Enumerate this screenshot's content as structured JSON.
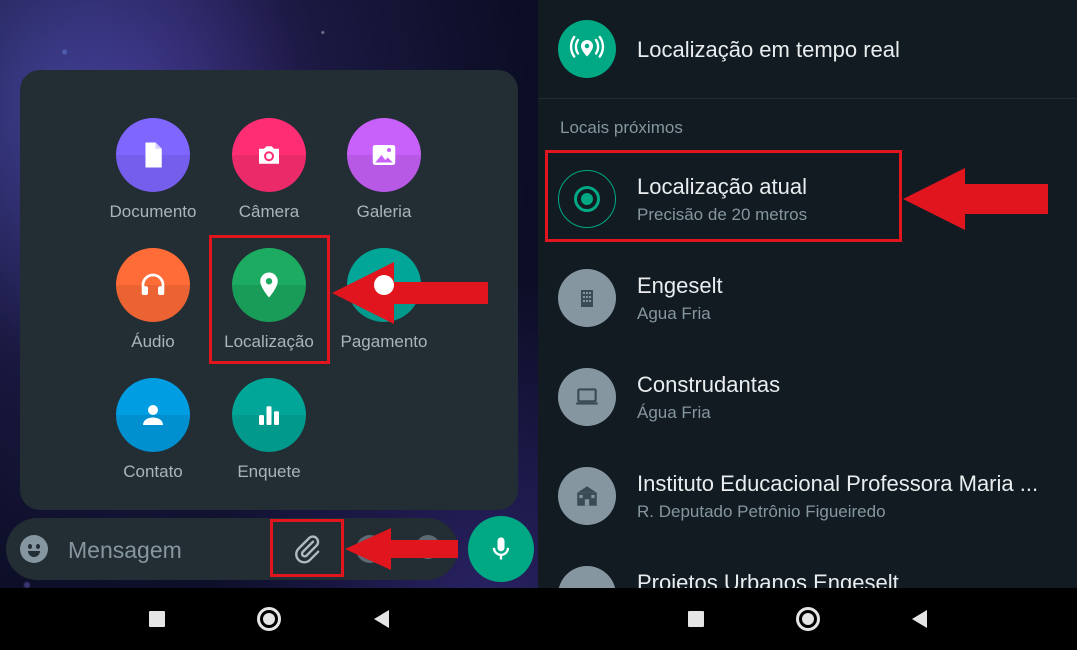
{
  "left": {
    "attach_items": [
      {
        "label": "Documento",
        "icon": "document-icon",
        "color": "#7f66ff"
      },
      {
        "label": "Câmera",
        "icon": "camera-icon",
        "color": "#ff2e74"
      },
      {
        "label": "Galeria",
        "icon": "gallery-icon",
        "color": "#c861fa"
      },
      {
        "label": "Áudio",
        "icon": "headphones-icon",
        "color": "#ff6c37"
      },
      {
        "label": "Localização",
        "icon": "location-pin-icon",
        "color": "#1daa61"
      },
      {
        "label": "Pagamento",
        "icon": "payment-icon",
        "color": "#02a698"
      },
      {
        "label": "Contato",
        "icon": "contact-icon",
        "color": "#009de2"
      },
      {
        "label": "Enquete",
        "icon": "poll-icon",
        "color": "#02a698"
      }
    ],
    "message_placeholder": "Mensagem"
  },
  "right": {
    "live_location": {
      "title": "Localização em tempo real",
      "icon": "live-location-icon"
    },
    "section_label": "Locais próximos",
    "current_location": {
      "title": "Localização atual",
      "subtitle": "Precisão de 20 metros"
    },
    "places": [
      {
        "title": "Engeselt",
        "subtitle": "Agua Fria",
        "icon": "building-icon"
      },
      {
        "title": "Construdantas",
        "subtitle": "Água Fria",
        "icon": "computer-icon"
      },
      {
        "title": "Instituto Educacional Professora Maria ...",
        "subtitle": "R. Deputado Petrônio Figueiredo",
        "icon": "school-icon"
      },
      {
        "title": "Projetos Urbanos Engeselt",
        "subtitle": "",
        "icon": "building-icon"
      }
    ]
  },
  "colors": {
    "accent": "#00a884",
    "annotation": "#e0151d",
    "panel": "#222d34",
    "background_right": "#111b21"
  }
}
